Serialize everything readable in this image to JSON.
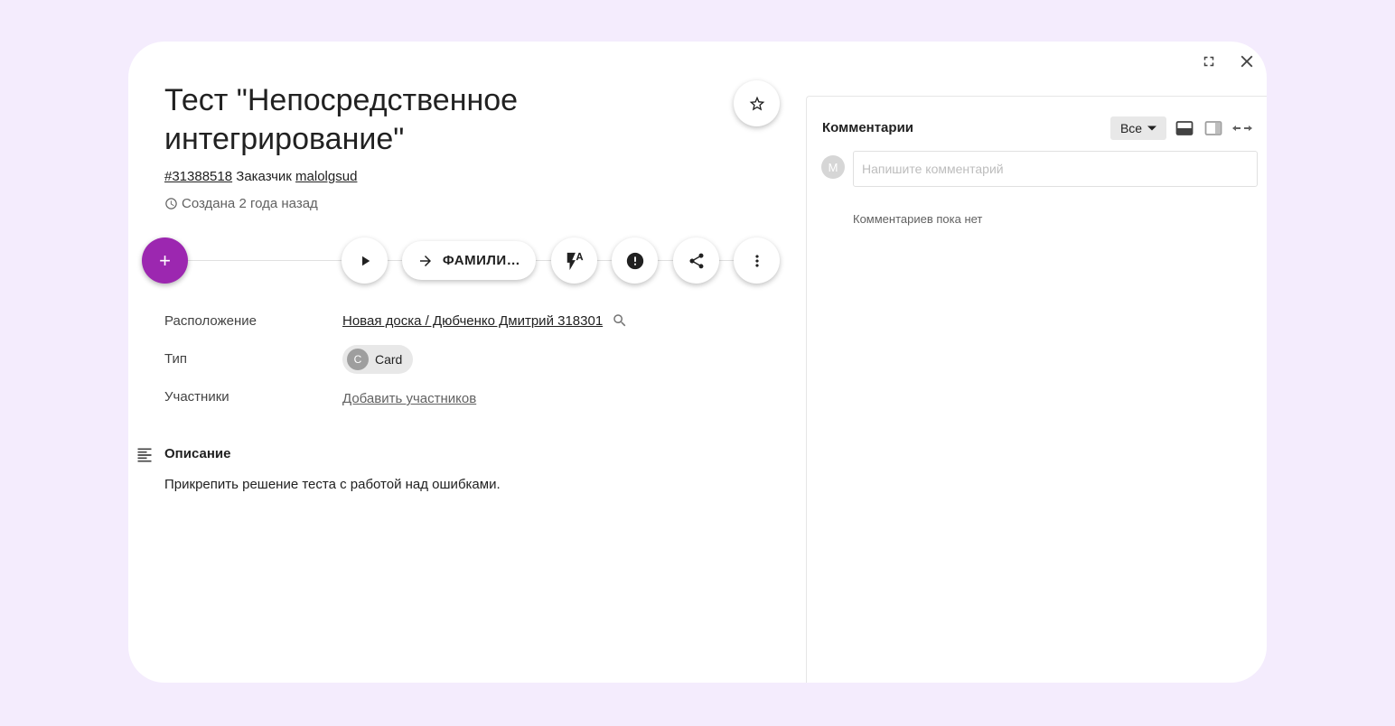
{
  "task": {
    "title": "Тест \"Непосредственное интегрирование\"",
    "id": "#31388518",
    "customer_label": "Заказчик",
    "customer": "malolgsud",
    "created": "Создана 2 года назад"
  },
  "toolbar": {
    "add": "+",
    "transition_label": "ФАМИЛИ…"
  },
  "fields": {
    "location_label": "Расположение",
    "location_value": "Новая доска / Дюбченко Дмитрий 318301",
    "type_label": "Тип",
    "type_avatar": "C",
    "type_value": "Card",
    "members_label": "Участники",
    "members_add": "Добавить участников"
  },
  "description": {
    "title": "Описание",
    "text": "Прикрепить решение теста с работой над ошибками."
  },
  "comments": {
    "title": "Комментарии",
    "filter": "Все",
    "avatar": "M",
    "placeholder": "Напишите комментарий",
    "empty": "Комментариев пока нет"
  },
  "colors": {
    "accent": "#9c27b0",
    "background": "#f4ecfd"
  },
  "icons": [
    "expand-icon",
    "close-icon",
    "star-icon",
    "plus-icon",
    "play-icon",
    "arrow-right-icon",
    "flash-auto-icon",
    "alert-icon",
    "share-icon",
    "more-vert-icon",
    "search-icon",
    "description-icon",
    "clock-icon",
    "caret-down-icon",
    "view-bottom-icon",
    "view-side-icon",
    "swap-width-icon"
  ]
}
